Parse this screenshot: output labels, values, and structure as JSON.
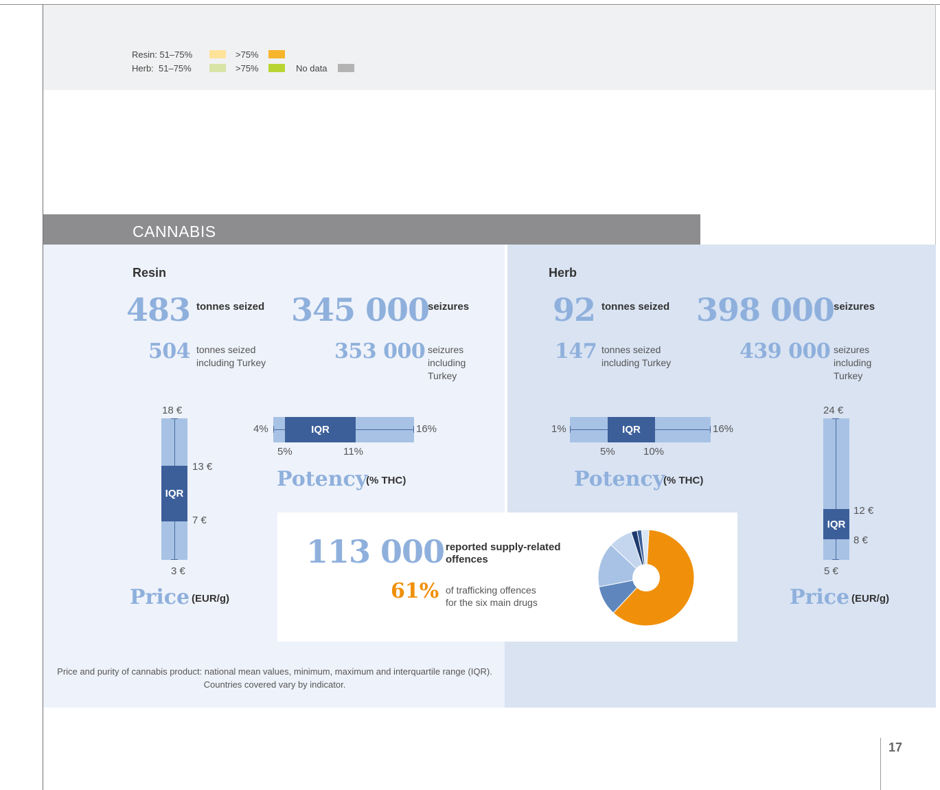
{
  "legend": {
    "resin_label": "Resin: 51–75%",
    "resin_high": ">75%",
    "herb_label": "Herb:  51–75%",
    "herb_high": ">75%",
    "no_data": "No data",
    "colors": {
      "resin_mid": "#fde29a",
      "resin_high": "#f6b52a",
      "herb_mid": "#d8e4a6",
      "herb_high": "#b8d433",
      "no_data": "#b3b3b3"
    }
  },
  "section_title": "CANNABIS",
  "resin": {
    "heading": "Resin",
    "tonnes": "483",
    "tonnes_label": "tonnes seized",
    "seizures": "345 000",
    "seizures_label": "seizures",
    "tonnes_tr": "504",
    "tonnes_tr_label1": "tonnes seized",
    "tonnes_tr_label2": "including Turkey",
    "seizures_tr": "353 000",
    "seizures_tr_label1": "seizures",
    "seizures_tr_label2": "including",
    "seizures_tr_label3": "Turkey",
    "price": {
      "max": "18 €",
      "q3": "13 €",
      "q1": "7 €",
      "min": "3 €",
      "iqr": "IQR",
      "title": "Price",
      "unit": "(EUR/g)"
    },
    "potency": {
      "min": "4%",
      "max": "16%",
      "q1": "5%",
      "q3": "11%",
      "iqr": "IQR",
      "title": "Potency",
      "unit": "(% THC)"
    }
  },
  "herb": {
    "heading": "Herb",
    "tonnes": "92",
    "tonnes_label": "tonnes seized",
    "seizures": "398 000",
    "seizures_label": "seizures",
    "tonnes_tr": "147",
    "tonnes_tr_label1": "tonnes seized",
    "tonnes_tr_label2": "including Turkey",
    "seizures_tr": "439 000",
    "seizures_tr_label1": "seizures",
    "seizures_tr_label2": "including",
    "seizures_tr_label3": "Turkey",
    "price": {
      "max": "24 €",
      "q3": "12 €",
      "q1": "8 €",
      "min": "5 €",
      "iqr": "IQR",
      "title": "Price",
      "unit": "(EUR/g)"
    },
    "potency": {
      "min": "1%",
      "max": "16%",
      "q1": "5%",
      "q3": "10%",
      "iqr": "IQR",
      "title": "Potency",
      "unit": "(% THC)"
    }
  },
  "offences": {
    "count": "113 000",
    "label1": "reported supply-related",
    "label2": "offences",
    "share": "61%",
    "share_label1": "of trafficking offences",
    "share_label2": "for the six main drugs"
  },
  "chart_data": {
    "type": "pie",
    "values": [
      61,
      10,
      15,
      8,
      2,
      1.5,
      2.5
    ],
    "colors": [
      "#f0900a",
      "#5f87bd",
      "#a7c2e4",
      "#c3d6ee",
      "#1f3a6e",
      "#3c5f9a",
      "#dbe6f5"
    ]
  },
  "caption": {
    "line1": "Price and purity of cannabis product: national mean values, minimum, maximum and interquartile range (IQR).",
    "line2": "Countries covered vary by indicator."
  },
  "page_number": "17"
}
